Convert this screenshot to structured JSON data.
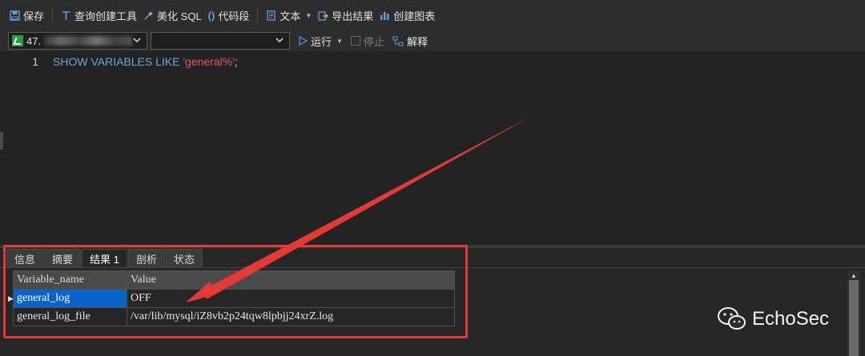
{
  "toolbar": {
    "save": "保存",
    "query_builder": "查询创建工具",
    "beautify_sql": "美化 SQL",
    "code_snippet": "代码段",
    "text": "文本",
    "export_results": "导出结果",
    "create_chart": "创建图表"
  },
  "connection": {
    "label": "47.",
    "database": ""
  },
  "run_controls": {
    "run": "运行",
    "stop": "停止",
    "explain": "解释"
  },
  "editor": {
    "line_number": "1",
    "keyword": "SHOW VARIABLES LIKE",
    "string": "'general%'",
    "terminator": ";"
  },
  "result_tabs": [
    "信息",
    "摘要",
    "结果 1",
    "剖析",
    "状态"
  ],
  "result_grid": {
    "headers": [
      "Variable_name",
      "Value"
    ],
    "rows": [
      [
        "general_log",
        "OFF"
      ],
      [
        "general_log_file",
        "/var/lib/mysql/iZ8vb2p24tqw8lpbjj24xrZ.log"
      ]
    ]
  },
  "watermark": "EchoSec",
  "colors": {
    "annotation_red": "#e53935",
    "selection_blue": "#0a64c8",
    "keyword_blue": "#6aa9d8",
    "string_red": "#e0566e",
    "run_blue": "#3b8fe0"
  }
}
